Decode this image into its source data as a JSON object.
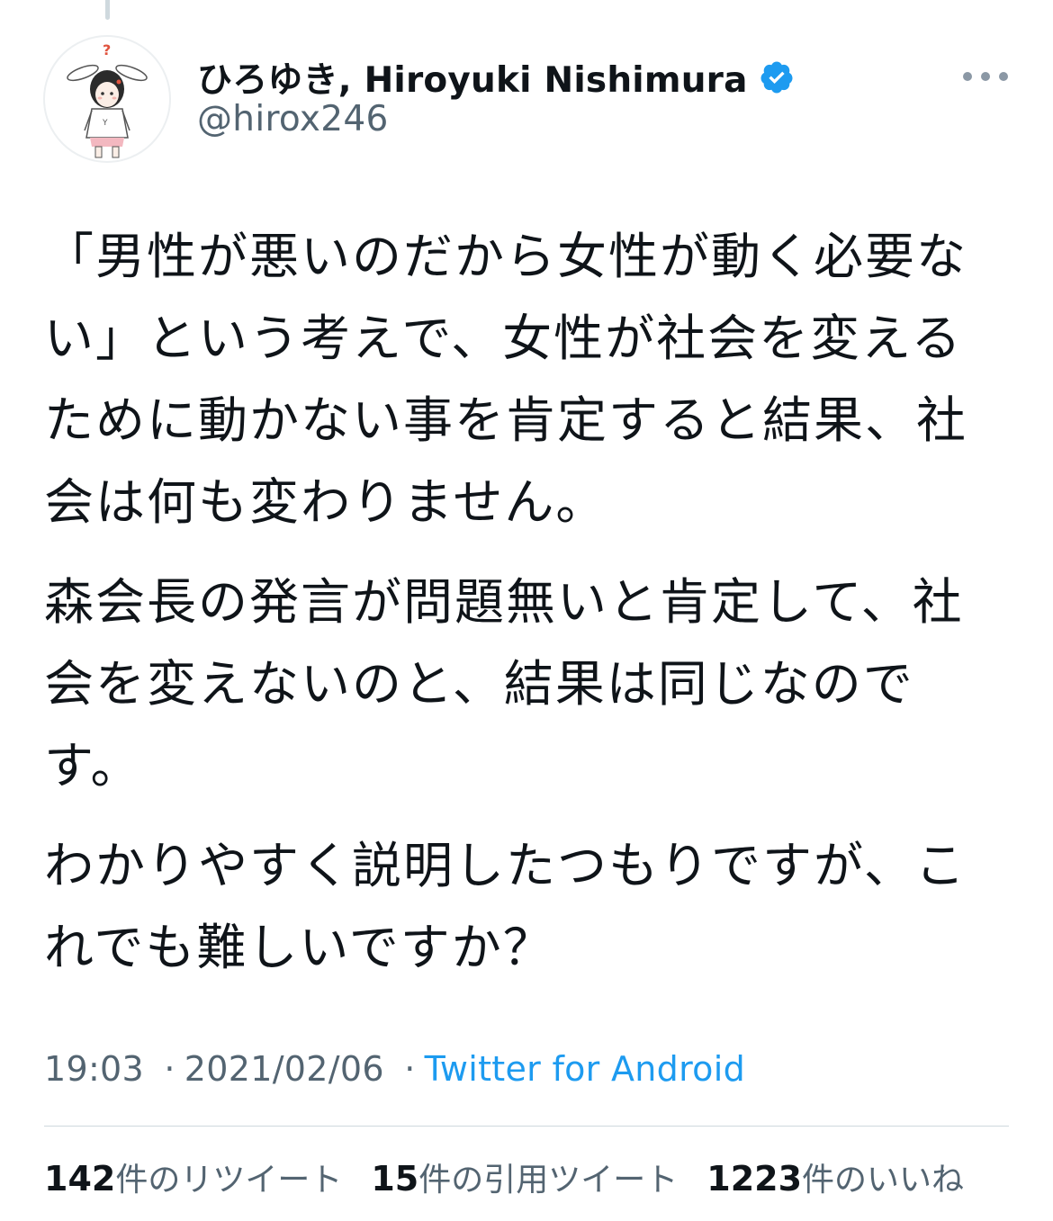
{
  "tweet": {
    "author": {
      "display_name": "ひろゆき, Hiroyuki Nishimura",
      "handle": "@hirox246",
      "verified": true,
      "avatar_icon": "bunny-ear-character-avatar",
      "avatar_question_mark": "?"
    },
    "more_icon": "more-horizontal-icon",
    "paragraphs": [
      {
        "lines": [
          "「男性が悪いのだから女性が動く必要な",
          "い」という考えで、女性が社会を変える",
          "ために動かない事を肯定すると結果、社",
          "会は何も変わりません。"
        ]
      },
      {
        "lines": [
          "森会長の発言が問題無いと肯定して、社",
          "会を変えないのと、結果は同じなので",
          "す。"
        ]
      },
      {
        "lines": [
          "わかりやすく説明したつもりですが、こ",
          "れでも難しいですか？"
        ]
      }
    ],
    "meta": {
      "time": "19:03",
      "separator": "·",
      "date": "2021/02/06",
      "source": "Twitter for Android"
    },
    "stats": [
      {
        "count": "142",
        "label": "件のリツイート"
      },
      {
        "count": "15",
        "label": "件の引用ツイート"
      },
      {
        "count": "1223",
        "label": "件のいいね"
      }
    ]
  },
  "colors": {
    "text_primary": "#0f1419",
    "text_secondary": "#536471",
    "link": "#1d9bf0",
    "verified_badge": "#1d9bf0",
    "divider": "#cfd9de"
  }
}
